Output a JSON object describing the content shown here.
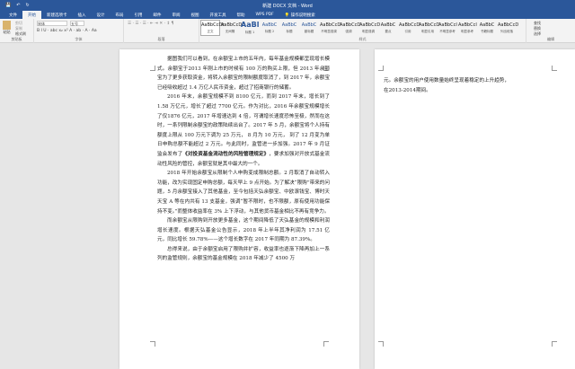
{
  "title": "新建 DOCX 文档 - Word",
  "quick_access": [
    "💾",
    "↶",
    "↻"
  ],
  "tabs": [
    "文件",
    "开始",
    "新建选项卡",
    "插入",
    "设计",
    "布局",
    "引用",
    "邮件",
    "审阅",
    "视图",
    "开发工具",
    "帮助",
    "WPS PDF",
    "💡 操作说明搜索"
  ],
  "clipboard": {
    "paste": "粘贴",
    "cut": "剪切",
    "copy": "复制",
    "format": "格式刷",
    "label": "剪贴板"
  },
  "font": {
    "name": "宋体",
    "size": "五号",
    "label": "字体",
    "buttons": "B  I  U · abc x₂ x²   A · ab · A · Aa"
  },
  "paragraph": {
    "label": "段落",
    "buttons": "☰ · ☰ · ☰ ·  ⇤ ⇥  ✕ · ↕ ¶"
  },
  "styles": {
    "label": "样式",
    "items": [
      {
        "p": "AaBbCcDc",
        "n": "正文"
      },
      {
        "p": "AaBbCcDc",
        "n": "无间隔"
      },
      {
        "p": "AaBl",
        "n": "标题 1"
      },
      {
        "p": "AaBbC",
        "n": "标题 2"
      },
      {
        "p": "AaBbC",
        "n": "标题"
      },
      {
        "p": "AaBbC",
        "n": "副标题"
      },
      {
        "p": "AaBbCcD",
        "n": "不明显强调"
      },
      {
        "p": "AaBbCcD",
        "n": "强调"
      },
      {
        "p": "AaBbCcD",
        "n": "明显强调"
      },
      {
        "p": "AaBbC",
        "n": "要点"
      },
      {
        "p": "AaBbCcD",
        "n": "引用"
      },
      {
        "p": "AaBbCcD",
        "n": "明显引用"
      },
      {
        "p": "AaBbCcI",
        "n": "不明显参考"
      },
      {
        "p": "AaBbCcI",
        "n": "明显参考"
      },
      {
        "p": "AaBbC",
        "n": "书籍标题"
      },
      {
        "p": "AaBbCcD",
        "n": "列出段落"
      }
    ]
  },
  "editing": {
    "find": "查找",
    "replace": "替换",
    "select": "选择",
    "label": "编辑"
  },
  "page1": {
    "paragraphs": [
      "据图我们可以看到，在余额宝上市的五年内，每年基金规模都呈现增长模式。余额宝于2013 年刚上市的时候有 100 万的购买上限，但 2013 年余额宝为了更多获取资金，将转入余额宝的限制额度取消了，到 2017 年，余额宝已经吸收超过 1.4 万亿人民币资金，超过了招商银行的储蓄。",
      "2016 年末，余额宝规模不到 8100 亿元，而到 2017 年末，增长到了 1.58 万亿元，增长了超过 7700 亿元。作为对比，2016 年余额宝规模增长了仅1876 亿元，2017 年增速达到 4 倍，可谓增长速度恐怖至极，然而在这时，一系列限制余额宝的政策陆续出台了。2017 年 5 月，余额宝将个人持有额度上限从 100 万元下调为 25 万元， 8 月为 10 万元， 到了 12 月变为单日申购总额不能超过 2 万元。与此同时，监管进一步加强。2017 年 9 月证监会发布了",
      "2018 年开始余额宝从限制个人申购变成限制总额。2 月取消了自动转入功能，改为实现固定申购总额，每天早上 9 点开始。为了解决“限购”带来的问题，5 月余额宝接入了其他基金，至今包括天弘余额宝、中欧滚钱宝、博时天天宝 A 等在内共有 13 支基金，强调“暂不限时，也不限额，原有使用功能保持不变。”而整体收益率在 3% 上下浮动，与其他货币基金相比不再有竞争力。",
      "而余额宝从限购到开放更多基金，这个期间降低了天弘基金的规模和利润增长速度。根据天弘基金公告显示，2018 年上半年其净利润为 17.51 亿元，同比增长 59.78%——这个增长数字在 2017 年同期为 87.39%。",
      "总得来说，由于余额宝启用了限购并扩容，收益率也逐渐下降再加上一系列的监管规则，余额宝的基金规模在 2018 年减少了 4500 万"
    ],
    "bold": "《对投资基金流动性的风险管理规定》",
    "after_bold": "，要求加强对开放式基金流动性风险的管控，余额宝就是其中最大的一个。"
  },
  "page2": {
    "text": "元。余额宝的用户使用数量始终呈现着稳定的上升趋势，在2013-2014期间。"
  }
}
